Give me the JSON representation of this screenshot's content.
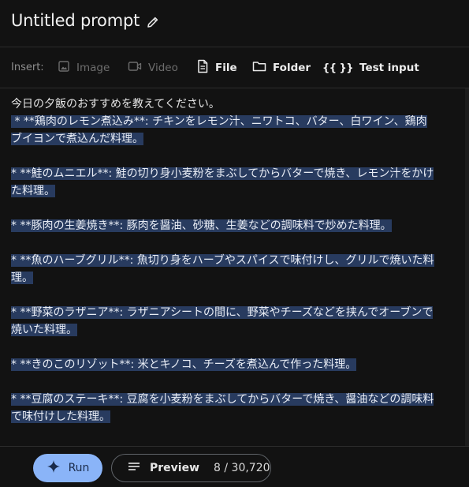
{
  "header": {
    "title": "Untitled prompt"
  },
  "insert_bar": {
    "label": "Insert:",
    "items": [
      {
        "label": "Image",
        "icon": "image-icon",
        "enabled": false
      },
      {
        "label": "Video",
        "icon": "video-icon",
        "enabled": false
      },
      {
        "label": "File",
        "icon": "file-icon",
        "enabled": true
      },
      {
        "label": "Folder",
        "icon": "folder-icon",
        "enabled": true
      },
      {
        "label": "Test input",
        "icon": "braces-icon",
        "enabled": true,
        "glyph": "{{ }}"
      }
    ]
  },
  "editor": {
    "lines": [
      {
        "text": "今日の夕飯のおすすめを教えてください。",
        "highlighted": false
      },
      {
        "text": " * **鶏肉のレモン煮込み**: チキンをレモン汁、ニワトコ、バター、白ワイン、鶏肉",
        "highlighted": true
      },
      {
        "text": "ブイヨンで煮込んだ料理。",
        "highlighted": true
      },
      {
        "text": "",
        "highlighted": false
      },
      {
        "text": "* **鮭のムニエル**: 鮭の切り身小麦粉をまぶしてからバターで焼き、レモン汁をかけ",
        "highlighted": true
      },
      {
        "text": "た料理。",
        "highlighted": true
      },
      {
        "text": "",
        "highlighted": false
      },
      {
        "text": "* **豚肉の生姜焼き**: 豚肉を醤油、砂糖、生姜などの調味料で炒めた料理。",
        "highlighted": true
      },
      {
        "text": "",
        "highlighted": false
      },
      {
        "text": "* **魚のハーブグリル**: 魚切り身をハーブやスパイスで味付けし、グリルで焼いた料",
        "highlighted": true
      },
      {
        "text": "理。",
        "highlighted": true
      },
      {
        "text": "",
        "highlighted": false
      },
      {
        "text": "* **野菜のラザニア**: ラザニアシートの間に、野菜やチーズなどを挟んでオーブンで",
        "highlighted": true
      },
      {
        "text": "焼いた料理。",
        "highlighted": true
      },
      {
        "text": "",
        "highlighted": false
      },
      {
        "text": "* **きのこのリゾット**: 米とキノコ、チーズを煮込んで作った料理。",
        "highlighted": true
      },
      {
        "text": "",
        "highlighted": false
      },
      {
        "text": "* **豆腐のステーキ**: 豆腐を小麦粉をまぶしてからバターで焼き、醤油などの調味料",
        "highlighted": true
      },
      {
        "text": "で味付けした料理。",
        "highlighted": true
      }
    ]
  },
  "footer": {
    "run_label": "Run",
    "preview_label": "Preview",
    "token_count": "8 / 30,720"
  },
  "colors": {
    "background": "#121212",
    "selection": "#283b5f",
    "run_button": "#8ab4f8"
  }
}
